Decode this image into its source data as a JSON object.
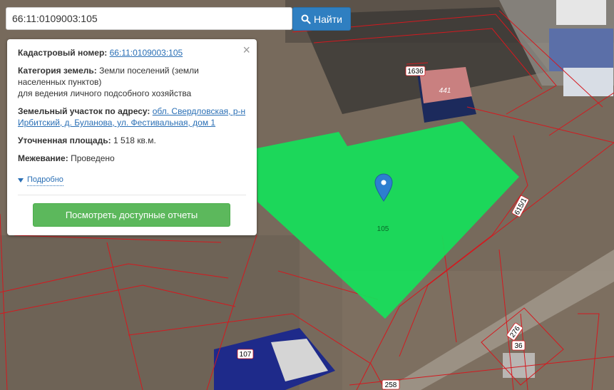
{
  "search": {
    "query": "66:11:0109003:105",
    "button_label": "Найти"
  },
  "popup": {
    "cadastral_label": "Кадастровый номер:",
    "cadastral_value": "66:11:0109003:105",
    "category_label": "Категория земель:",
    "category_value": "Земли поселений (земли",
    "category_value_2": "населенных пунктов)",
    "usage": "для ведения личного подсобного хозяйства",
    "address_label": "Земельный участок по адресу:",
    "address_value_1": "обл. Свердловская, р-н",
    "address_value_2": "Ирбитский, д. Буланова, ул. Фестивальная, дом 1",
    "area_label": "Уточненная площадь:",
    "area_value": "1 518 кв.м.",
    "survey_label": "Межевание:",
    "survey_value": "Проведено",
    "more_label": "Подробно",
    "reports_button": "Посмотреть доступные отчеты",
    "close_symbol": "×"
  },
  "map": {
    "selected_parcel_label": "105",
    "parcel_labels": [
      "1636",
      "441",
      "615/1",
      "107",
      "276",
      "36",
      "258"
    ],
    "colors": {
      "selected_fill": "#16e05a",
      "boundary": "#d4191f",
      "building_fill": "#c98080",
      "marker": "#2d7fd0"
    }
  }
}
